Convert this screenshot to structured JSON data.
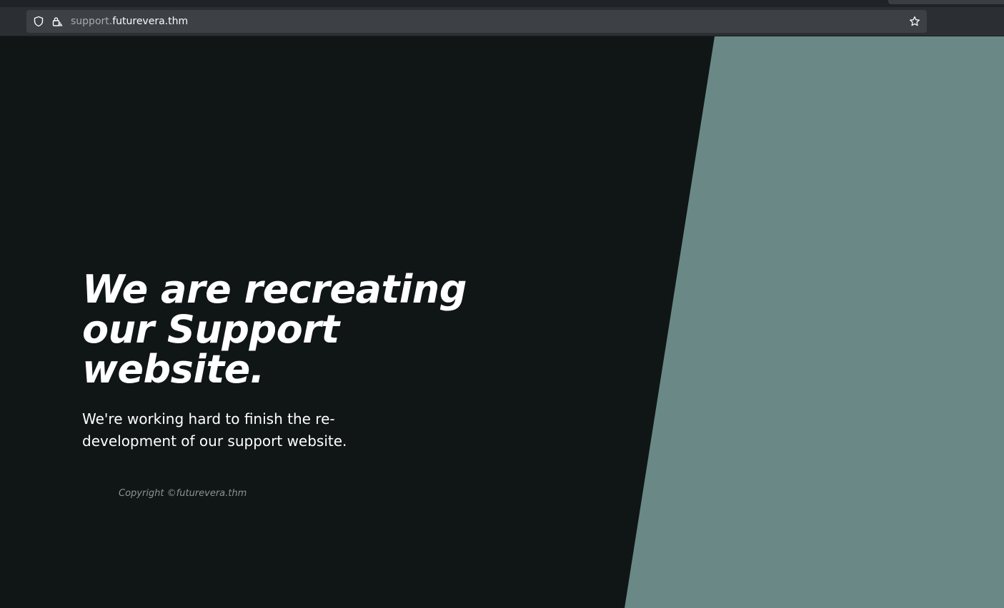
{
  "browser": {
    "url_subdomain": "support.",
    "url_domain": "futurevera.thm",
    "icons": [
      "shield-icon",
      "lock-warning-icon",
      "star-bookmark-icon"
    ]
  },
  "hero": {
    "title": "We are recreating our Support website.",
    "subtitle": "We're working hard to finish the re-development of our support website."
  },
  "footer": {
    "copyright": "Copyright ©futurevera.thm"
  },
  "colors": {
    "background_dark": "#101616",
    "panel_teal": "#6a8986",
    "text_light": "#ffffff",
    "copyright_muted": "#8b9393"
  }
}
